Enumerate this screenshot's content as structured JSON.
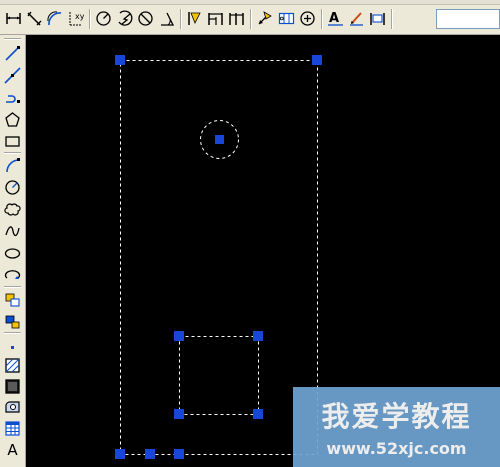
{
  "app": {
    "name": "CAD drawing workspace"
  },
  "toolbar_top": {
    "groups": [
      [
        "linear-dimension-icon",
        "aligned-dimension-icon",
        "arc-length-icon",
        "ordinate-dimension-icon"
      ],
      [
        "radius-dimension-icon",
        "jogged-dimension-icon",
        "diameter-dimension-icon",
        "angular-dimension-icon"
      ],
      [
        "quick-dimension-icon",
        "baseline-dimension-icon",
        "continue-dimension-icon"
      ],
      [
        "quick-leader-icon",
        "tolerance-icon",
        "center-mark-icon"
      ],
      [
        "dimension-edit-icon",
        "dimension-text-edit-icon",
        "dimension-update-icon"
      ]
    ],
    "style_combo_value": ""
  },
  "toolbar_left": {
    "tools": [
      "line-icon",
      "construction-line-icon",
      "polyline-icon",
      "polygon-icon",
      "rectangle-icon",
      "arc-icon",
      "circle-icon",
      "revision-cloud-icon",
      "spline-icon",
      "ellipse-icon",
      "ellipse-arc-icon",
      "insert-block-icon",
      "make-block-icon",
      "point-icon",
      "hatch-icon",
      "gradient-icon",
      "region-icon",
      "table-icon",
      "mtext-icon"
    ],
    "mtext_label": "A"
  },
  "drawing": {
    "background": "#000000",
    "grip_color": "#1846d8",
    "dash_color": "#ffffff"
  },
  "watermark": {
    "title": "我爱学教程",
    "url": "www.52xjc.com",
    "background": "#6fa3d2"
  }
}
